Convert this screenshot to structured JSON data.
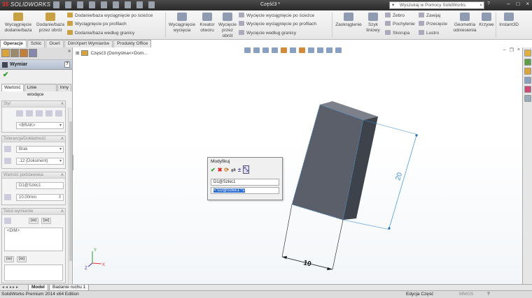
{
  "titlebar": {
    "app": "SOLIDWORKS",
    "document_title": "Część3 *",
    "search_placeholder": "Wyszukaj w Pomocy SolidWorks",
    "help_label": "?"
  },
  "ribbon": {
    "big_buttons": [
      {
        "label": "Wyciągnięcie dodanie/baza"
      },
      {
        "label": "Dodanie/baza przez obrót"
      },
      {
        "label": "Wyciągnięcie wycięcia"
      },
      {
        "label": "Kreator otworu"
      },
      {
        "label": "Wycięcie przez obrót"
      },
      {
        "label": "Zaokrąglenie"
      },
      {
        "label": "Szyk liniowy"
      },
      {
        "label": "Geometria odniesienia"
      },
      {
        "label": "Krzywe"
      },
      {
        "label": "Instant3D"
      }
    ],
    "small_buttons": [
      {
        "label": "Dodanie/baza wyciągnięcie po ścieżce"
      },
      {
        "label": "Wyciągnięcie po profilach"
      },
      {
        "label": "Dodanie/baza według granicy"
      },
      {
        "label": "Wycięcie wyciągnięcie po ścieżce"
      },
      {
        "label": "Wycięcie wyciągnięcie po profilach"
      },
      {
        "label": "Wycięcie według granicy"
      },
      {
        "label": "Żebro"
      },
      {
        "label": "Pochylenie"
      },
      {
        "label": "Skorupa"
      },
      {
        "label": "Zawijaj"
      },
      {
        "label": "Przecięcie"
      },
      {
        "label": "Lustro"
      }
    ]
  },
  "command_tabs": [
    {
      "label": "Operacje",
      "active": true
    },
    {
      "label": "Szkic"
    },
    {
      "label": "Oceń"
    },
    {
      "label": "DimXpert Wymiarów"
    },
    {
      "label": "Produkty Office"
    }
  ],
  "property_manager": {
    "title": "Wymiar",
    "tabs": [
      {
        "label": "Wartość",
        "active": true
      },
      {
        "label": "Linie wiodące"
      },
      {
        "label": "Inny"
      }
    ],
    "style": {
      "header": "Styl",
      "value": "<BRAK>"
    },
    "tolerance": {
      "header": "Tolerancja/Dokładność",
      "type_value": "Brak",
      "precision_value": ".12 (Dokument)"
    },
    "primary_value": {
      "header": "Wartość podstawowa",
      "name": "D1@Szkic1",
      "value": "10.00mm"
    },
    "dimension_text": {
      "header": "Tekst wymiarów",
      "text": "<DIM>",
      "buttons": [
        "(xx)",
        "[xx]"
      ]
    }
  },
  "graphics": {
    "tree_node": "Część3  (Domyślna<<Dom...",
    "dimensions": {
      "width": "10",
      "height": "20"
    },
    "triad_axes": [
      "X",
      "Y",
      "Z"
    ]
  },
  "modify_dialog": {
    "title": "Modyfikuj",
    "dimension_name": "D1@Szkic1",
    "expression": "=\"D2@Szkic1\"*2"
  },
  "bottom_tabs": [
    {
      "label": "Model",
      "active": true
    },
    {
      "label": "Badanie ruchu 1"
    }
  ],
  "status_bar": {
    "left": "SolidWorks Premium 2014 x64 Edition",
    "mode": "Edycja Część",
    "units": "MMGS",
    "help": "?"
  },
  "colors": {
    "part_face": "#5a5f69",
    "part_side": "#3c414a",
    "dimension_line": "#3b8fd6",
    "selection_blue": "#2f6fd1"
  }
}
